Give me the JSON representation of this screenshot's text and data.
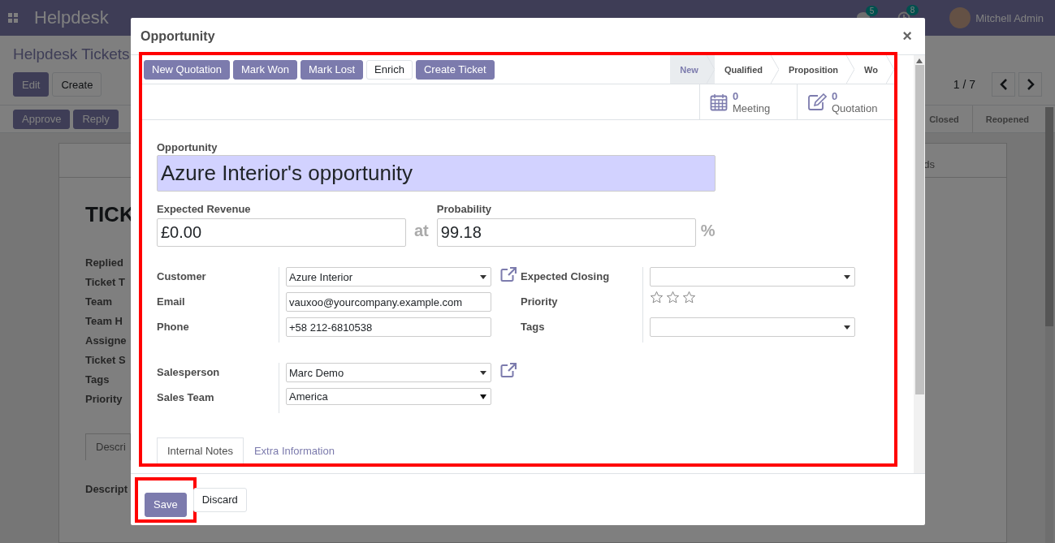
{
  "app_bar": {
    "title": "Helpdesk",
    "messages_badge": "5",
    "activities_badge": "8",
    "user": "Mitchell Admin"
  },
  "control_panel": {
    "breadcrumb": "Helpdesk Tickets",
    "buttons": [
      {
        "label": "Edit",
        "kind": "primary"
      },
      {
        "label": "Create",
        "kind": "secondary"
      }
    ],
    "pager": "1 / 7"
  },
  "ticket_header": {
    "buttons": [
      {
        "label": "Approve",
        "kind": "primary"
      },
      {
        "label": "Reply",
        "kind": "primary"
      }
    ],
    "stages": [
      "Closed",
      "Reopened"
    ]
  },
  "ticket_sheet": {
    "tab": "ds",
    "title": "TICK",
    "fields": [
      "Replied",
      "Ticket T",
      "Team",
      "Team H",
      "Assigne",
      "Ticket S",
      "Tags",
      "Priority"
    ],
    "notebook_tab": "Descri",
    "description_label": "Descript"
  },
  "dialog": {
    "title": "Opportunity",
    "close": "×",
    "actions": [
      {
        "label": "New Quotation",
        "kind": "primary"
      },
      {
        "label": "Mark Won",
        "kind": "primary"
      },
      {
        "label": "Mark Lost",
        "kind": "primary"
      },
      {
        "label": "Enrich",
        "kind": "secondary"
      },
      {
        "label": "Create Ticket",
        "kind": "primary"
      }
    ],
    "stages": [
      {
        "label": "New",
        "selected": true
      },
      {
        "label": "Qualified",
        "selected": false
      },
      {
        "label": "Proposition",
        "selected": false
      },
      {
        "label": "Wo",
        "selected": false
      }
    ],
    "stat_buttons": [
      {
        "kind": "calendar",
        "value": "0",
        "label": "Meeting"
      },
      {
        "kind": "edit",
        "value": "0",
        "label": "Quotation"
      }
    ],
    "name_label": "Opportunity",
    "name": "Azure Interior's opportunity",
    "revenue_label": "Expected Revenue",
    "revenue": "£0.00",
    "at": "at",
    "probability_label": "Probability",
    "probability": "99.18",
    "percent": "%",
    "left_group": [
      {
        "label": "Customer",
        "kind": "many2one",
        "value": "Azure Interior",
        "link": true
      },
      {
        "label": "Email",
        "kind": "input",
        "value": "vauxoo@yourcompany.example.com",
        "link": false
      },
      {
        "label": "Phone",
        "kind": "input",
        "value": "+58 212-6810538",
        "link": false
      }
    ],
    "right_group": [
      {
        "label": "Expected Closing",
        "kind": "dropdown"
      },
      {
        "label": "Priority",
        "kind": "stars",
        "stars": 0
      },
      {
        "label": "Tags",
        "kind": "dropdown"
      }
    ],
    "sales_group": [
      {
        "label": "Salesperson",
        "kind": "many2one",
        "value": "Marc Demo",
        "link": true
      },
      {
        "label": "Sales Team",
        "kind": "select",
        "value": "America",
        "link": false
      }
    ],
    "tabs": [
      {
        "label": "Internal Notes",
        "selected": true
      },
      {
        "label": "Extra Information",
        "selected": false
      }
    ],
    "footer": [
      {
        "label": "Save",
        "kind": "primary",
        "highlighted": true
      },
      {
        "label": "Discard",
        "kind": "secondary",
        "highlighted": false
      }
    ]
  }
}
